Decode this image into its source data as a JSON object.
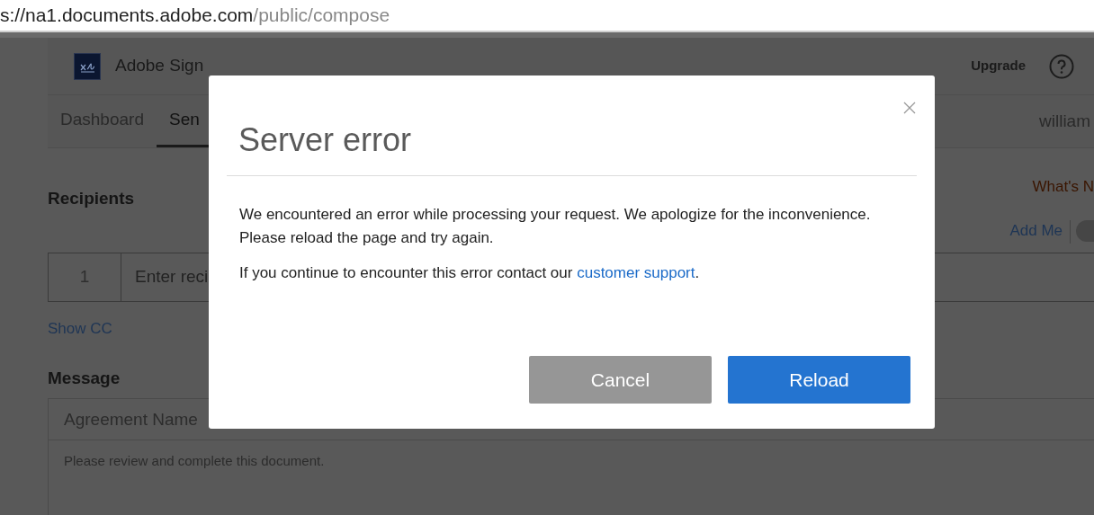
{
  "address_bar": {
    "host": "s://na1.documents.adobe.com",
    "path": "/public/compose"
  },
  "header": {
    "brand": "Adobe Sign",
    "upgrade": "Upgrade"
  },
  "nav": {
    "tabs": [
      {
        "label": "Dashboard",
        "selected": false
      },
      {
        "label": "Sen",
        "selected": true
      }
    ],
    "user": "william"
  },
  "whats_new": "What's N",
  "recipients": {
    "title": "Recipients",
    "add_me": "Add Me",
    "rows": [
      {
        "number": "1",
        "placeholder": "Enter reci"
      }
    ],
    "show_cc": "Show CC"
  },
  "message": {
    "title": "Message",
    "name_placeholder": "Agreement Name",
    "body": "Please review and complete this document."
  },
  "dialog": {
    "title": "Server error",
    "lines": [
      "We encountered an error while processing your request. We apologize for the inconvenience.",
      "Please reload the page and try again."
    ],
    "contact_text": "If you continue to encounter this error contact our",
    "link": "customer support",
    "after_link": ".",
    "buttons": [
      {
        "label": "Cancel",
        "kind": "secondary"
      },
      {
        "label": "Reload",
        "kind": "primary"
      }
    ]
  }
}
